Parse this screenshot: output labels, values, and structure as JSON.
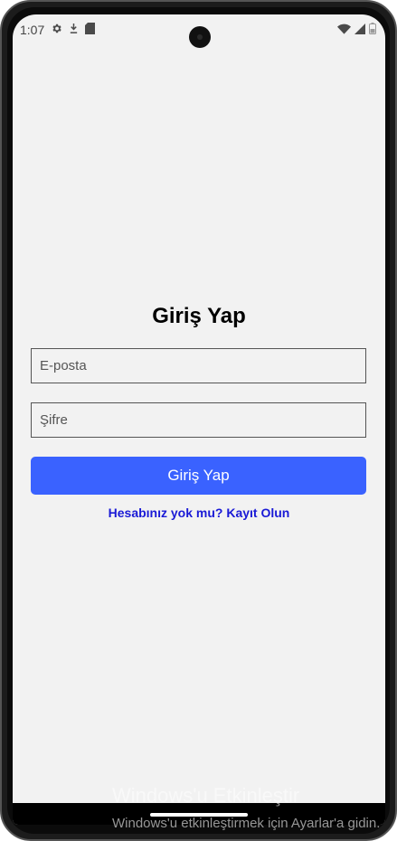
{
  "status_bar": {
    "time": "1:07",
    "icons": [
      "gear-icon",
      "download-icon",
      "sd-card-icon",
      "wifi-icon",
      "cellular-signal-icon",
      "battery-icon"
    ]
  },
  "login": {
    "title": "Giriş Yap",
    "email_placeholder": "E-posta",
    "password_placeholder": "Şifre",
    "submit_label": "Giriş Yap",
    "register_link": "Hesabınız yok mu? Kayıt Olun"
  },
  "colors": {
    "background": "#f2f2f2",
    "button": "#3a62ff",
    "link": "#1a1ad6"
  },
  "watermark": {
    "title": "Windows'u Etkinleştir",
    "subtitle": "Windows'u etkinleştirmek için Ayarlar'a gidin."
  }
}
